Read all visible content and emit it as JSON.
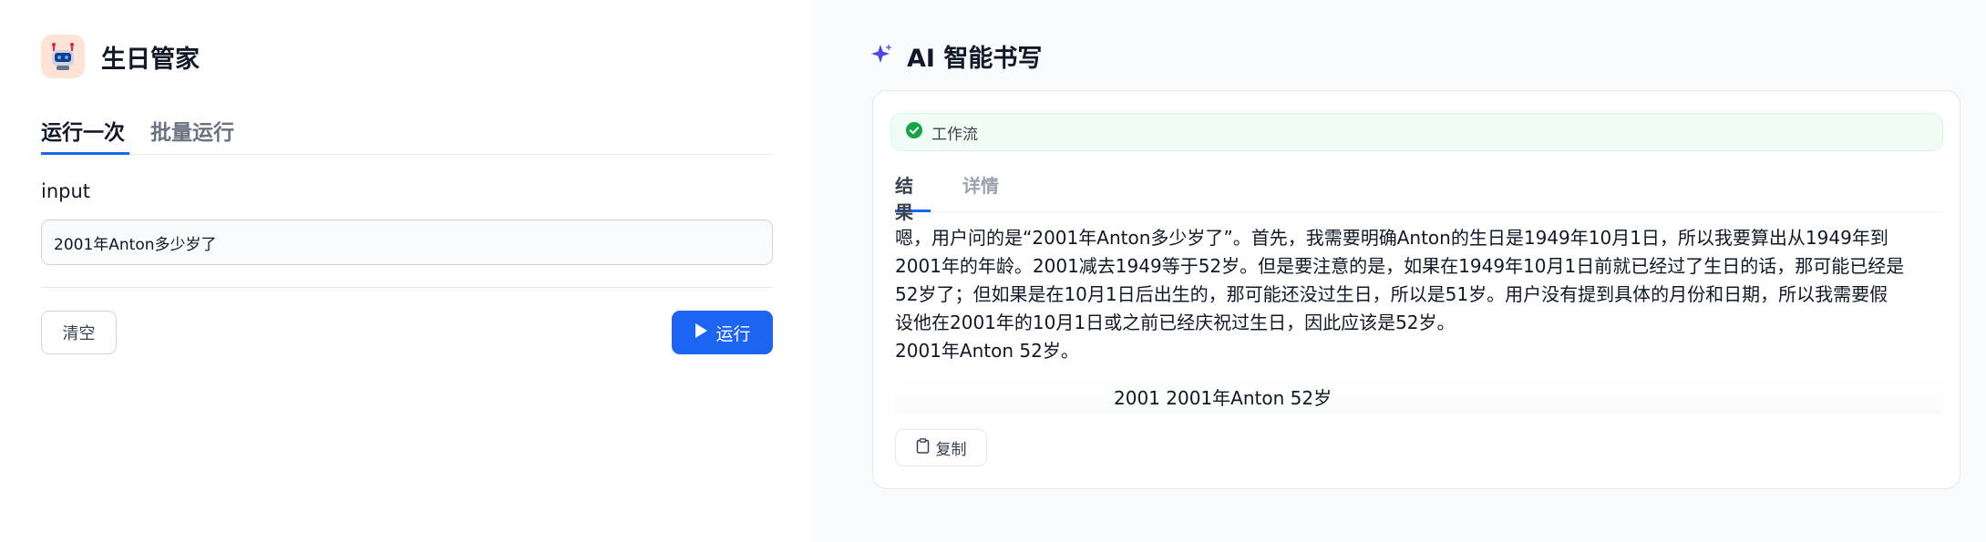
{
  "app": {
    "title": "生日管家",
    "icon": "robot-icon"
  },
  "left_tabs": [
    {
      "label": "运行一次",
      "active": true
    },
    {
      "label": "批量运行",
      "active": false
    }
  ],
  "form": {
    "field_label": "input",
    "input_value": "2001年Anton多少岁了"
  },
  "actions": {
    "clear_label": "清空",
    "run_label": "运行"
  },
  "output": {
    "title": "AI 智能书写",
    "title_icon": "sparkle-icon",
    "workflow_status": "工作流",
    "status_icon": "check-circle-icon",
    "tabs": [
      {
        "label": "结果",
        "active": true
      },
      {
        "label": "详情",
        "active": false
      }
    ],
    "result_lines": [
      "嗯，用户问的是“2001年Anton多少岁了”。首先，我需要明确Anton的生日是1949年10月1日，所以我要算出从1949年到",
      "2001年的年龄。2001减去1949等于52岁。但是要注意的是，如果在1949年10月1日前就已经过了生日的话，那可能已经是",
      "52岁了；但如果是在10月1日后出生的，那可能还没过生日，所以是51岁。用户没有提到具体的月份和日期，所以我需要假",
      "设他在2001年的10月1日或之前已经庆祝过生日，因此应该是52岁。",
      "2001年Anton 52岁。"
    ],
    "answer": "2001 2001年Anton 52岁",
    "copy_label": "复制",
    "copy_icon": "clipboard-icon"
  },
  "colors": {
    "accent": "#1c64f2",
    "success": "#16a34a",
    "sparkle": "#4f46e5"
  }
}
